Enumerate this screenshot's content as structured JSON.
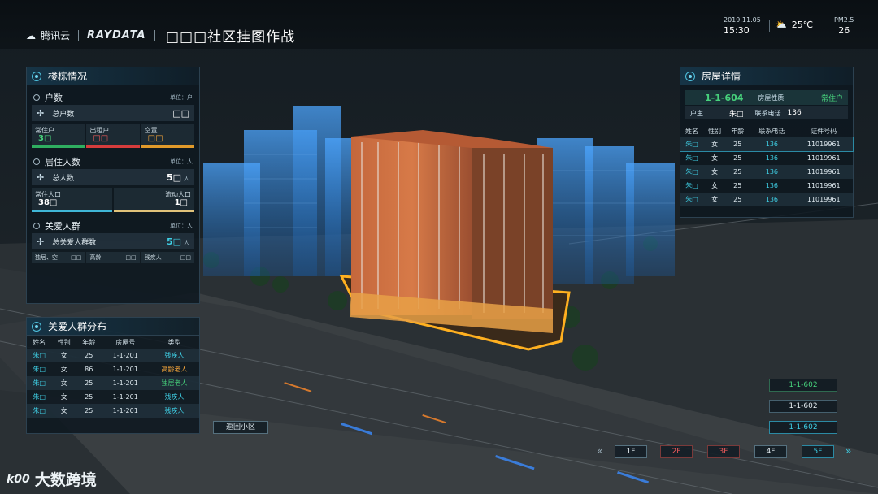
{
  "brand": {
    "cloud": "腾讯云",
    "raydata": "RAYDATA"
  },
  "title": "□□□社区挂图作战",
  "header": {
    "date": "2019.11.05",
    "time": "15:30",
    "temp": "25℃",
    "pm_label": "PM2.5",
    "pm_value": "26"
  },
  "buildings": {
    "title": "楼栋情况",
    "households": {
      "label": "户数",
      "unit": "单位：户",
      "total_label": "总户数",
      "total_value": "□□",
      "resident_label": "常住户",
      "resident_value": "3□",
      "rent_label": "出租户",
      "rent_value": "□□",
      "vacant_label": "空置",
      "vacant_value": "□□"
    },
    "residents": {
      "label": "居住人数",
      "unit": "单位：人",
      "total_label": "总人数",
      "total_value": "5□",
      "total_unit": "人",
      "perm_label": "常住人口",
      "perm_value": "38□",
      "float_label": "流动人口",
      "float_value": "1□"
    },
    "care": {
      "label": "关爱人群",
      "unit": "单位：人",
      "total_label": "总关爱人群数",
      "total_value": "5□",
      "total_unit": "人",
      "alone_label": "独居、空",
      "alone_value": "□□",
      "elder_label": "高龄",
      "elder_value": "□□",
      "disabled_label": "残疾人",
      "disabled_value": "□□"
    }
  },
  "care_dist": {
    "title": "关爱人群分布",
    "headers": [
      "姓名",
      "性别",
      "年龄",
      "房屋号",
      "类型"
    ],
    "rows": [
      [
        "朱□",
        "女",
        "25",
        "1-1-201",
        "残疾人"
      ],
      [
        "朱□",
        "女",
        "86",
        "1-1-201",
        "高龄老人"
      ],
      [
        "朱□",
        "女",
        "25",
        "1-1-201",
        "独居老人"
      ],
      [
        "朱□",
        "女",
        "25",
        "1-1-201",
        "残疾人"
      ],
      [
        "朱□",
        "女",
        "25",
        "1-1-201",
        "残疾人"
      ]
    ]
  },
  "house": {
    "title": "房屋详情",
    "room": "1-1-604",
    "nature_label": "房屋性质",
    "nature": "常住户",
    "owner_label": "户主",
    "owner": "朱□",
    "phone_label": "联系电话",
    "phone": "136",
    "headers": [
      "姓名",
      "性别",
      "年龄",
      "联系电话",
      "证件号码"
    ],
    "rows": [
      [
        "朱□",
        "女",
        "25",
        "136",
        "11019961"
      ],
      [
        "朱□",
        "女",
        "25",
        "136",
        "11019961"
      ],
      [
        "朱□",
        "女",
        "25",
        "136",
        "11019961"
      ],
      [
        "朱□",
        "女",
        "25",
        "136",
        "11019961"
      ],
      [
        "朱□",
        "女",
        "25",
        "136",
        "11019961"
      ]
    ]
  },
  "back_label": "返回小区",
  "rooms": [
    "1-1-602",
    "1-1-602",
    "1-1-602"
  ],
  "floors": [
    "1F",
    "2F",
    "3F",
    "4F",
    "5F"
  ],
  "watermark": "大数跨境",
  "watermark_logo": "k00"
}
